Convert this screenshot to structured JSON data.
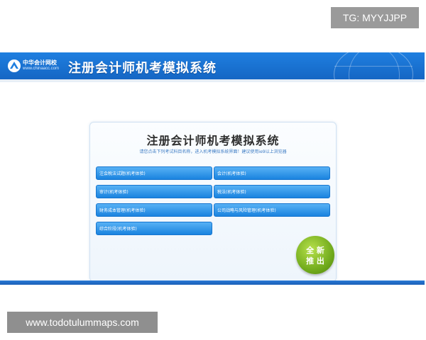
{
  "watermarks": {
    "top_right": "TG: MYYJJPP",
    "bottom_left": "www.todotulummaps.com"
  },
  "header": {
    "logo_cn": "中华会计网校",
    "logo_en": "www.chinaacc.com",
    "title": "注册会计师机考模拟系统"
  },
  "panel": {
    "title": "注册会计师机考模拟系统",
    "subtitle": "请您点击下列考试科目名称，进入机考模拟系统界面！建议使用ie9以上浏览器"
  },
  "exams": [
    {
      "label": "注会税法试题(机考体验)"
    },
    {
      "label": "会计(机考体验)"
    },
    {
      "label": "审计(机考体验)"
    },
    {
      "label": "税法(机考体验)"
    },
    {
      "label": "财务成本管理(机考体验)"
    },
    {
      "label": "公司战略与风险管理(机考体验)"
    },
    {
      "label": "综合阶段(机考体验)"
    }
  ],
  "full_screen": {
    "line1": "全 新",
    "line2": "推 出"
  },
  "colors": {
    "header_blue": "#1f7fe0",
    "button_blue": "#1a83df",
    "badge_green": "#6ea81a"
  }
}
